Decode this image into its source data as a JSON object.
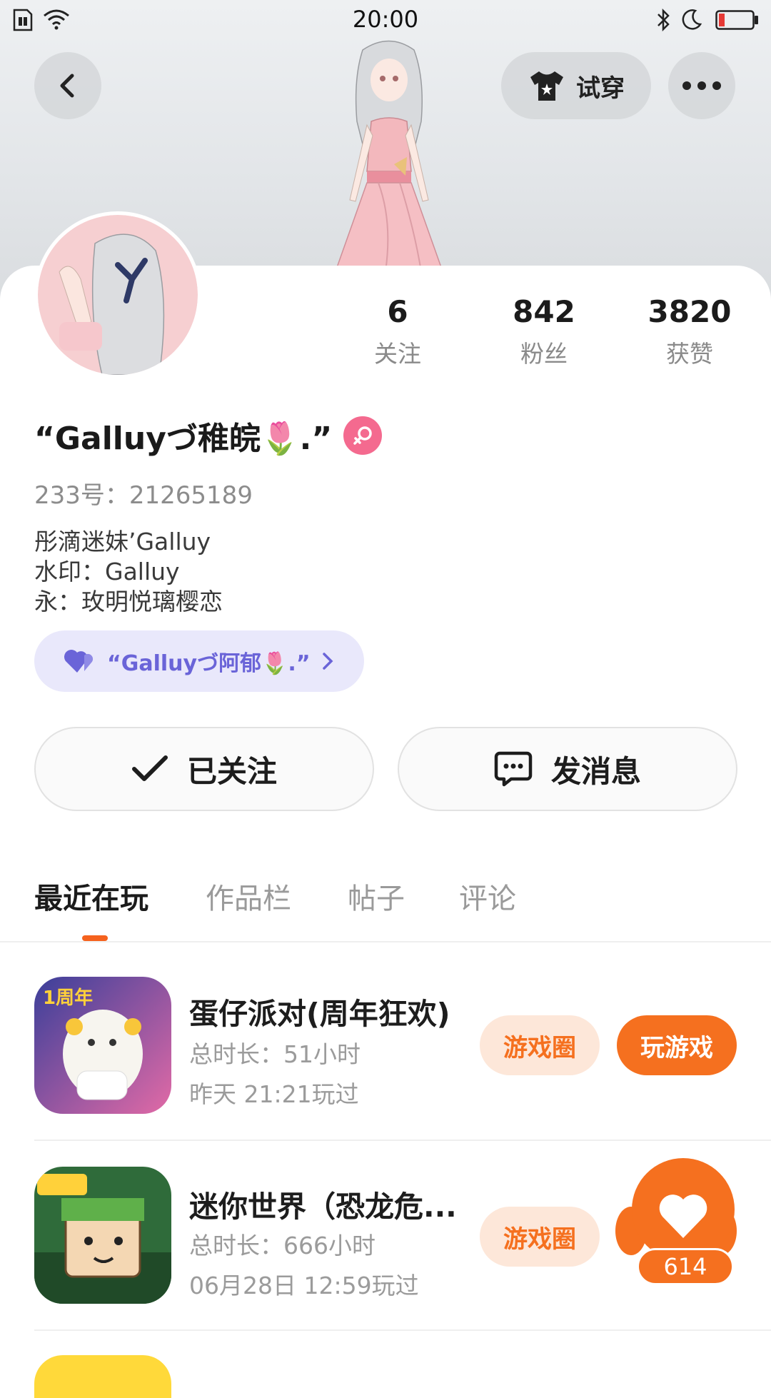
{
  "status_bar": {
    "time": "20:00"
  },
  "header": {
    "tryon_label": "试穿"
  },
  "stats": [
    {
      "value": "6",
      "label": "关注"
    },
    {
      "value": "842",
      "label": "粉丝"
    },
    {
      "value": "3820",
      "label": "获赞"
    }
  ],
  "profile": {
    "nickname": "“Galluyづ稚皖🌷.”",
    "uid": "233号：21265189",
    "bio": [
      "彤滴迷妹’Galluy",
      "水印：Galluy",
      "永：玫明悦璃樱恋"
    ],
    "cp_label": "“Galluyづ阿郁🌷.”"
  },
  "actions": {
    "follow_label": "已关注",
    "message_label": "发消息"
  },
  "tabs": [
    {
      "label": "最近在玩",
      "active": true
    },
    {
      "label": "作品栏",
      "active": false
    },
    {
      "label": "帖子",
      "active": false
    },
    {
      "label": "评论",
      "active": false
    }
  ],
  "games": [
    {
      "title": "蛋仔派对(周年狂欢)",
      "duration": "总时长：51小时",
      "last_played": "昨天 21:21玩过",
      "circle_label": "游戏圈",
      "play_label": "玩游戏",
      "icon_badge": "1周年"
    },
    {
      "title": "迷你世界（恐龙危...",
      "duration": "总时长：666小时",
      "last_played": "06月28日 12:59玩过",
      "circle_label": "游戏圈"
    }
  ],
  "like_button": {
    "count": "614"
  },
  "colors": {
    "accent": "#f5701f",
    "accent_light": "#fde7d9",
    "cp_bg": "#e9e8fb",
    "cp_text": "#6a64d8"
  }
}
